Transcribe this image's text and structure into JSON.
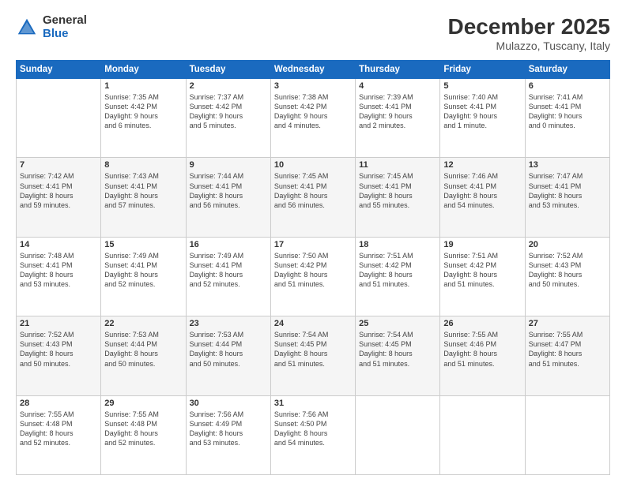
{
  "logo": {
    "general": "General",
    "blue": "Blue"
  },
  "header": {
    "month": "December 2025",
    "location": "Mulazzo, Tuscany, Italy"
  },
  "weekdays": [
    "Sunday",
    "Monday",
    "Tuesday",
    "Wednesday",
    "Thursday",
    "Friday",
    "Saturday"
  ],
  "weeks": [
    [
      {
        "day": "",
        "info": ""
      },
      {
        "day": "1",
        "info": "Sunrise: 7:35 AM\nSunset: 4:42 PM\nDaylight: 9 hours\nand 6 minutes."
      },
      {
        "day": "2",
        "info": "Sunrise: 7:37 AM\nSunset: 4:42 PM\nDaylight: 9 hours\nand 5 minutes."
      },
      {
        "day": "3",
        "info": "Sunrise: 7:38 AM\nSunset: 4:42 PM\nDaylight: 9 hours\nand 4 minutes."
      },
      {
        "day": "4",
        "info": "Sunrise: 7:39 AM\nSunset: 4:41 PM\nDaylight: 9 hours\nand 2 minutes."
      },
      {
        "day": "5",
        "info": "Sunrise: 7:40 AM\nSunset: 4:41 PM\nDaylight: 9 hours\nand 1 minute."
      },
      {
        "day": "6",
        "info": "Sunrise: 7:41 AM\nSunset: 4:41 PM\nDaylight: 9 hours\nand 0 minutes."
      }
    ],
    [
      {
        "day": "7",
        "info": "Sunrise: 7:42 AM\nSunset: 4:41 PM\nDaylight: 8 hours\nand 59 minutes."
      },
      {
        "day": "8",
        "info": "Sunrise: 7:43 AM\nSunset: 4:41 PM\nDaylight: 8 hours\nand 57 minutes."
      },
      {
        "day": "9",
        "info": "Sunrise: 7:44 AM\nSunset: 4:41 PM\nDaylight: 8 hours\nand 56 minutes."
      },
      {
        "day": "10",
        "info": "Sunrise: 7:45 AM\nSunset: 4:41 PM\nDaylight: 8 hours\nand 56 minutes."
      },
      {
        "day": "11",
        "info": "Sunrise: 7:45 AM\nSunset: 4:41 PM\nDaylight: 8 hours\nand 55 minutes."
      },
      {
        "day": "12",
        "info": "Sunrise: 7:46 AM\nSunset: 4:41 PM\nDaylight: 8 hours\nand 54 minutes."
      },
      {
        "day": "13",
        "info": "Sunrise: 7:47 AM\nSunset: 4:41 PM\nDaylight: 8 hours\nand 53 minutes."
      }
    ],
    [
      {
        "day": "14",
        "info": "Sunrise: 7:48 AM\nSunset: 4:41 PM\nDaylight: 8 hours\nand 53 minutes."
      },
      {
        "day": "15",
        "info": "Sunrise: 7:49 AM\nSunset: 4:41 PM\nDaylight: 8 hours\nand 52 minutes."
      },
      {
        "day": "16",
        "info": "Sunrise: 7:49 AM\nSunset: 4:41 PM\nDaylight: 8 hours\nand 52 minutes."
      },
      {
        "day": "17",
        "info": "Sunrise: 7:50 AM\nSunset: 4:42 PM\nDaylight: 8 hours\nand 51 minutes."
      },
      {
        "day": "18",
        "info": "Sunrise: 7:51 AM\nSunset: 4:42 PM\nDaylight: 8 hours\nand 51 minutes."
      },
      {
        "day": "19",
        "info": "Sunrise: 7:51 AM\nSunset: 4:42 PM\nDaylight: 8 hours\nand 51 minutes."
      },
      {
        "day": "20",
        "info": "Sunrise: 7:52 AM\nSunset: 4:43 PM\nDaylight: 8 hours\nand 50 minutes."
      }
    ],
    [
      {
        "day": "21",
        "info": "Sunrise: 7:52 AM\nSunset: 4:43 PM\nDaylight: 8 hours\nand 50 minutes."
      },
      {
        "day": "22",
        "info": "Sunrise: 7:53 AM\nSunset: 4:44 PM\nDaylight: 8 hours\nand 50 minutes."
      },
      {
        "day": "23",
        "info": "Sunrise: 7:53 AM\nSunset: 4:44 PM\nDaylight: 8 hours\nand 50 minutes."
      },
      {
        "day": "24",
        "info": "Sunrise: 7:54 AM\nSunset: 4:45 PM\nDaylight: 8 hours\nand 51 minutes."
      },
      {
        "day": "25",
        "info": "Sunrise: 7:54 AM\nSunset: 4:45 PM\nDaylight: 8 hours\nand 51 minutes."
      },
      {
        "day": "26",
        "info": "Sunrise: 7:55 AM\nSunset: 4:46 PM\nDaylight: 8 hours\nand 51 minutes."
      },
      {
        "day": "27",
        "info": "Sunrise: 7:55 AM\nSunset: 4:47 PM\nDaylight: 8 hours\nand 51 minutes."
      }
    ],
    [
      {
        "day": "28",
        "info": "Sunrise: 7:55 AM\nSunset: 4:48 PM\nDaylight: 8 hours\nand 52 minutes."
      },
      {
        "day": "29",
        "info": "Sunrise: 7:55 AM\nSunset: 4:48 PM\nDaylight: 8 hours\nand 52 minutes."
      },
      {
        "day": "30",
        "info": "Sunrise: 7:56 AM\nSunset: 4:49 PM\nDaylight: 8 hours\nand 53 minutes."
      },
      {
        "day": "31",
        "info": "Sunrise: 7:56 AM\nSunset: 4:50 PM\nDaylight: 8 hours\nand 54 minutes."
      },
      {
        "day": "",
        "info": ""
      },
      {
        "day": "",
        "info": ""
      },
      {
        "day": "",
        "info": ""
      }
    ]
  ]
}
